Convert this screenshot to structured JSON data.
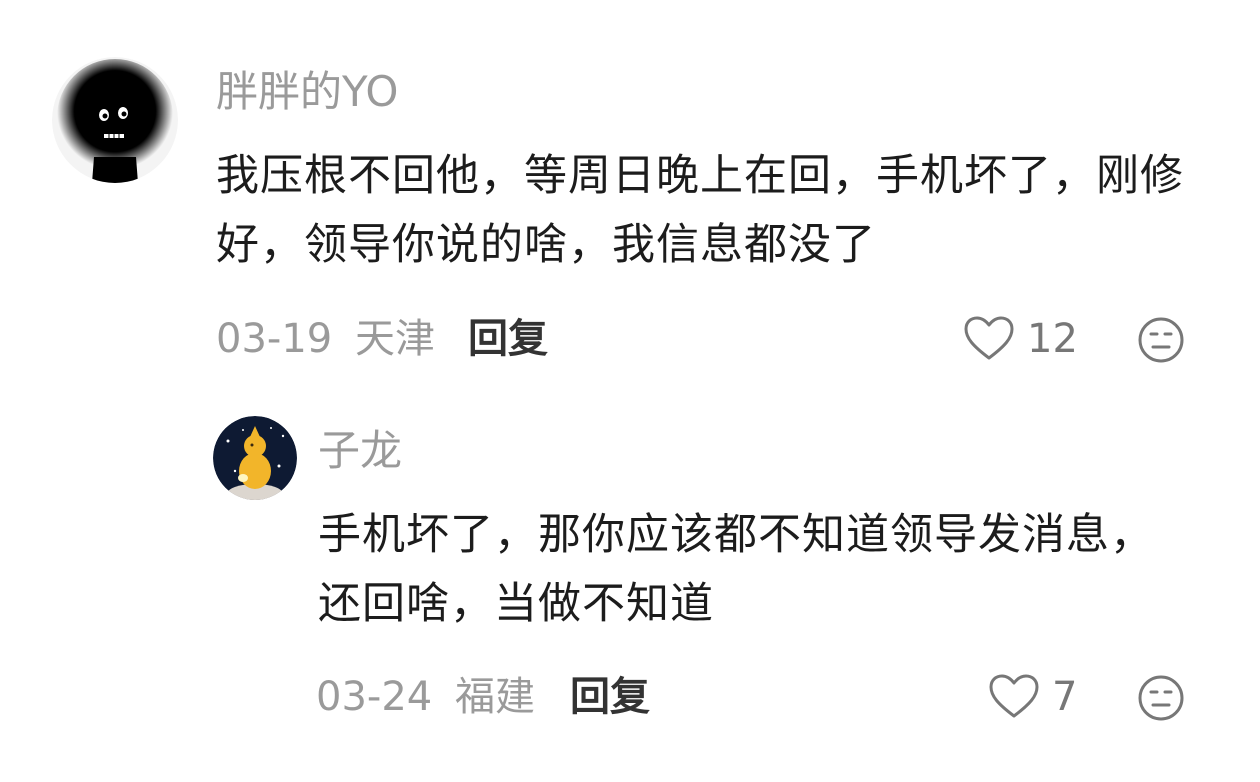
{
  "comments": [
    {
      "username": "胖胖的YO",
      "content": "我压根不回他，等周日晚上在回，手机坏了，刚修好，领导你说的啥，我信息都没了",
      "date": "03-19",
      "location": "天津",
      "reply_label": "回复",
      "likes": "12",
      "avatar_icon": "black-fuzzy-creature-avatar",
      "like_icon": "heart-outline-icon",
      "dislike_icon": "meh-face-icon"
    },
    {
      "username": "子龙",
      "content": "手机坏了，那你应该都不知道领导发消息，还回啥，当做不知道",
      "date": "03-24",
      "location": "福建",
      "reply_label": "回复",
      "likes": "7",
      "avatar_icon": "yellow-duck-night-sky-avatar",
      "like_icon": "heart-outline-icon",
      "dislike_icon": "meh-face-icon"
    }
  ]
}
